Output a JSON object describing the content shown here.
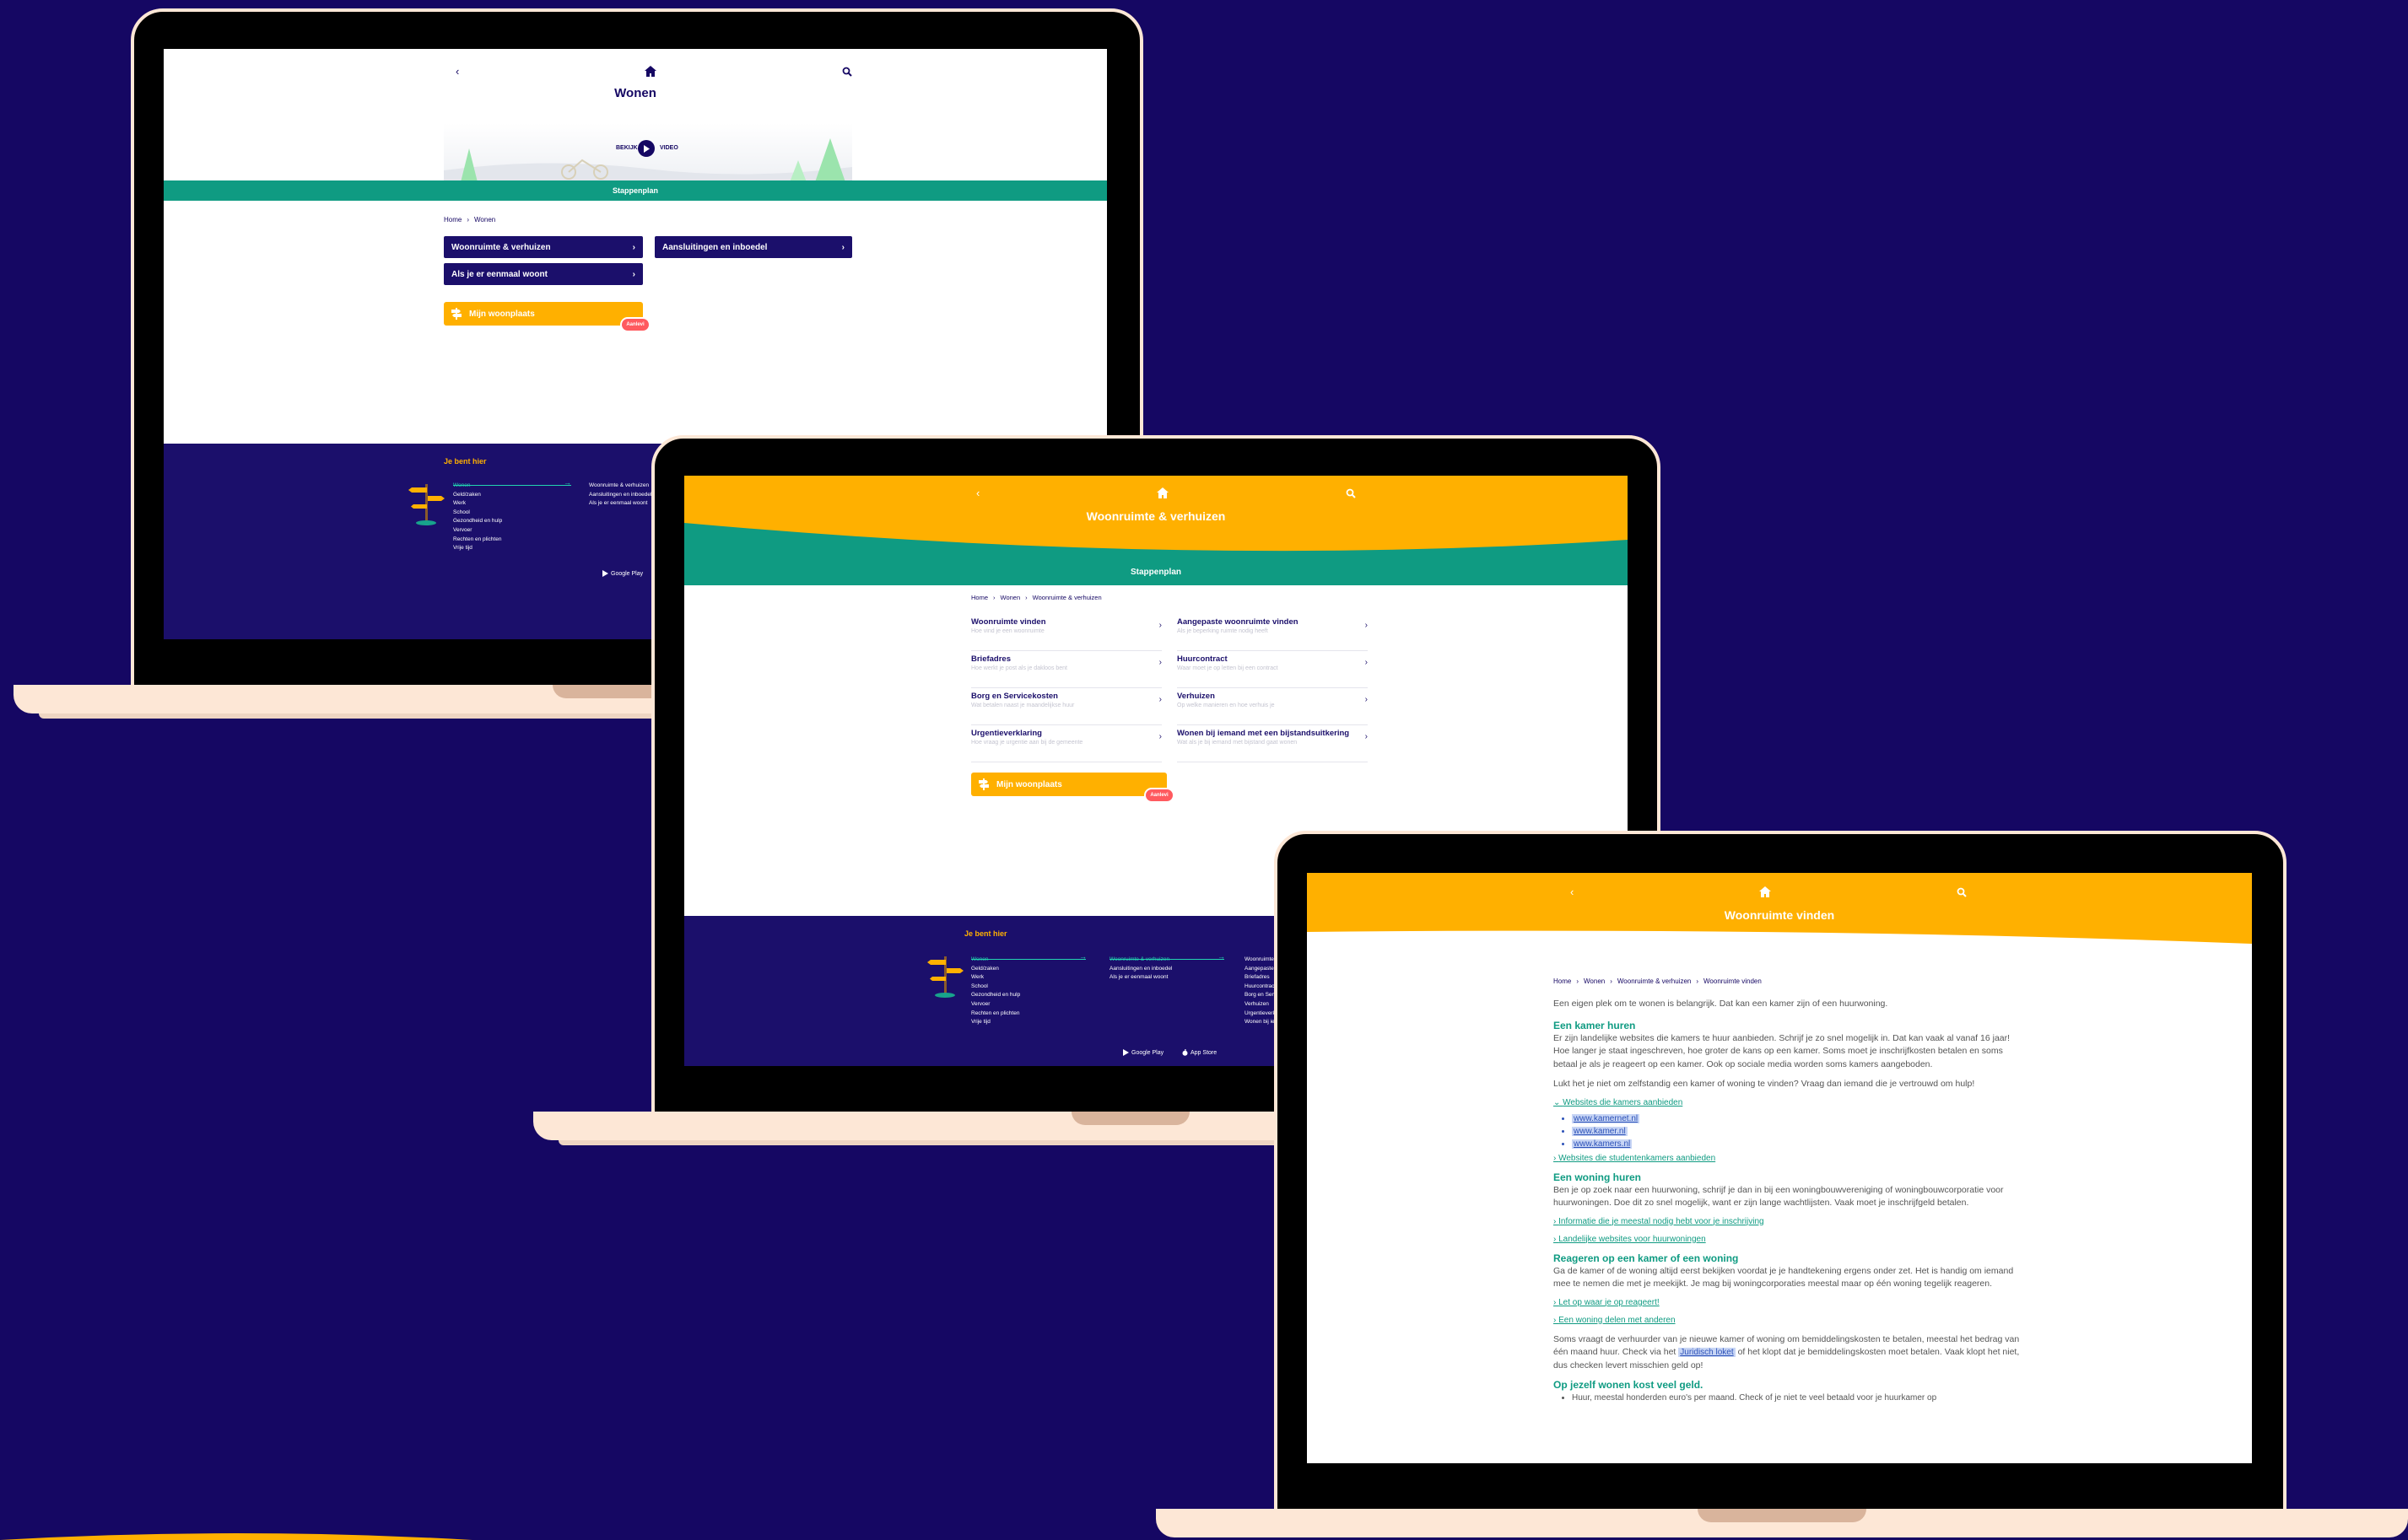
{
  "laptop1": {
    "title": "Wonen",
    "video": {
      "left": "BEKIJK",
      "right": "VIDEO"
    },
    "bar": "Stappenplan",
    "breadcrumb": [
      "Home",
      "Wonen"
    ],
    "buttons": [
      "Woonruimte & verhuizen",
      "Aansluitingen en inboedel",
      "Als je er eenmaal woont"
    ],
    "cta": {
      "label": "Mijn woonplaats",
      "badge": "Aanlevi"
    },
    "footer": {
      "heading": "Je bent hier",
      "col1": [
        "Wonen",
        "Geld/zaken",
        "Werk",
        "School",
        "Gezondheid en hulp",
        "Vervoer",
        "Rechten en plichten",
        "Vrije tijd"
      ],
      "col2": [
        "Woonruimte & verhuizen",
        "Aansluitingen en inboedel",
        "Als je er eenmaal woont"
      ],
      "store": "Google Play"
    }
  },
  "laptop2": {
    "title": "Woonruimte & verhuizen",
    "bar": "Stappenplan",
    "breadcrumb": [
      "Home",
      "Wonen",
      "Woonruimte & verhuizen"
    ],
    "items": [
      {
        "title": "Woonruimte vinden",
        "desc": "Hoe vind je een woonruimte"
      },
      {
        "title": "Aangepaste woonruimte vinden",
        "desc": "Als je beperking ruimte nodig heeft"
      },
      {
        "title": "Briefadres",
        "desc": "Hoe werkt je post als je dakloos bent"
      },
      {
        "title": "Huurcontract",
        "desc": "Waar moet je op letten bij een contract"
      },
      {
        "title": "Borg en Servicekosten",
        "desc": "Wat betalen naast je maandelijkse huur"
      },
      {
        "title": "Verhuizen",
        "desc": "Op welke manieren en hoe verhuis je"
      },
      {
        "title": "Urgentieverklaring",
        "desc": "Hoe vraag je urgentie aan bij de gemeente"
      },
      {
        "title": "Wonen bij iemand met een bijstandsuitkering",
        "desc": "Wat als je bij iemand met bijstand gaat wonen"
      }
    ],
    "cta": {
      "label": "Mijn woonplaats",
      "badge": "Aanlevi"
    },
    "footer": {
      "heading": "Je bent hier",
      "col1": [
        "Wonen",
        "Geld/zaken",
        "Werk",
        "School",
        "Gezondheid en hulp",
        "Vervoer",
        "Rechten en plichten",
        "Vrije tijd"
      ],
      "col2": [
        "Woonruimte & verhuizen",
        "Aansluitingen en inboedel",
        "Als je er eenmaal woont"
      ],
      "col3": [
        "Woonruimte vinden",
        "Aangepaste woonruimte vinden",
        "Briefadres",
        "Huurcontract",
        "Borg en Servicekosten",
        "Verhuizen",
        "Urgentieverklaring",
        "Wonen bij iemand"
      ],
      "stores": [
        "Google Play",
        "App Store"
      ]
    }
  },
  "laptop3": {
    "title": "Woonruimte vinden",
    "breadcrumb": [
      "Home",
      "Wonen",
      "Woonruimte & verhuizen",
      "Woonruimte vinden"
    ],
    "intro": "Een eigen plek om te wonen is belangrijk. Dat kan een kamer zijn of een huurwoning.",
    "h1": "Een kamer huren",
    "p1": "Er zijn landelijke websites die kamers te huur aanbieden. Schrijf je zo snel mogelijk in. Dat kan vaak al vanaf 16 jaar! Hoe langer je staat ingeschreven, hoe groter de kans op een kamer. Soms moet je inschrijfkosten betalen en soms betaal je als je reageert op een kamer. Ook op sociale media worden soms kamers aangeboden.",
    "p2": "Lukt het je niet om zelfstandig een kamer of woning te vinden? Vraag dan iemand die je vertrouwd om hulp!",
    "link1": "Websites die kamers aanbieden",
    "sites": [
      "www.kamernet.nl",
      "www.kamer.nl",
      "www.kamers.nl"
    ],
    "link2": "Websites die studentenkamers aanbieden",
    "h2": "Een woning huren",
    "p3": "Ben je op zoek naar een huurwoning, schrijf je dan in bij een woningbouwvereniging of woningbouwcorporatie voor huurwoningen. Doe dit zo snel mogelijk, want er zijn lange wachtlijsten. Vaak moet je inschrijfgeld betalen.",
    "link3": "Informatie die je meestal nodig hebt voor je inschrijving",
    "link4": "Landelijke websites voor huurwoningen",
    "h3": "Reageren op een kamer of een woning",
    "p4": "Ga de kamer of de woning altijd eerst bekijken voordat je je handtekening ergens onder zet. Het is handig om iemand mee te nemen die met je meekijkt. Je mag bij woningcorporaties meestal maar op één woning tegelijk reageren.",
    "link5": "Let op waar je op reageert!",
    "link6": "Een woning delen met anderen",
    "p5a": "Soms vraagt de verhuurder van je nieuwe kamer of woning om bemiddelingskosten te betalen, meestal het bedrag van één maand huur. Check via het",
    "p5link": "Juridisch loket",
    "p5b": "of het klopt dat je bemiddelingskosten moet betalen. Vaak klopt het niet, dus checken levert misschien geld op!",
    "h4": "Op jezelf wonen kost veel geld.",
    "li1": "Huur, meestal  honderden euro's per maand. Check of je niet te veel betaald voor je huurkamer op"
  },
  "colors": {
    "bg": "#150763",
    "navy": "#1b0f6b",
    "teal": "#0f9b82",
    "yellow": "#ffb000",
    "badge": "#ff5a5f",
    "frame": "#fde7d6"
  },
  "icons": {
    "back": "chevron-left-icon",
    "home": "home-icon",
    "search": "search-icon",
    "chevron": "chevron-right-icon",
    "signpost": "signpost-icon"
  }
}
